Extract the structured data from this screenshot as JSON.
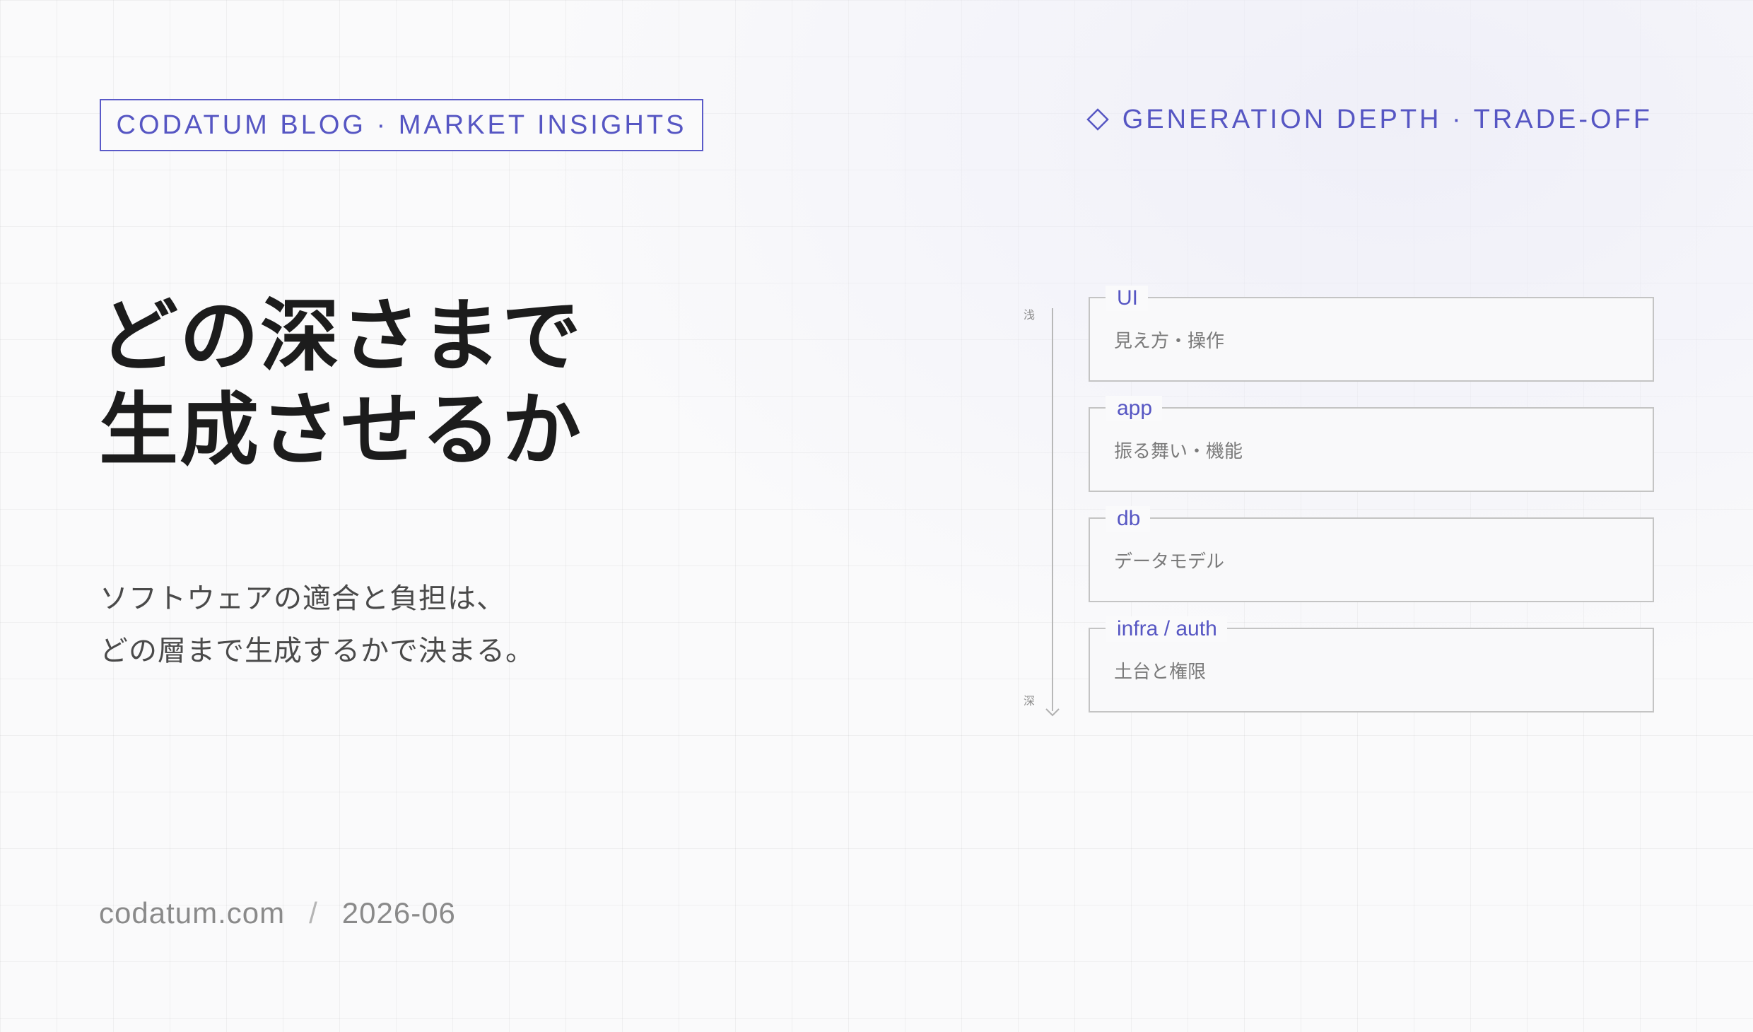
{
  "header": {
    "badge": "CODATUM BLOG · MARKET INSIGHTS",
    "section_tag": "GENERATION DEPTH · TRADE-OFF",
    "section_icon": "diamond-outline-icon"
  },
  "headline": {
    "line1": "どの深さまで",
    "line2": "生成させるか"
  },
  "subtext": {
    "line1": "ソフトウェアの適合と負担は、",
    "line2": "どの層まで生成するかで決まる。"
  },
  "footer": {
    "site": "codatum.com",
    "separator": "/",
    "date": "2026-06"
  },
  "axis": {
    "top_label": "浅",
    "bottom_label": "深",
    "arrow_icon": "chevron-down-icon"
  },
  "layers": [
    {
      "title": "UI",
      "desc": "見え方・操作"
    },
    {
      "title": "app",
      "desc": "振る舞い・機能"
    },
    {
      "title": "db",
      "desc": "データモデル"
    },
    {
      "title": "infra / auth",
      "desc": "土台と権限"
    }
  ],
  "colors": {
    "accent": "#5656c3",
    "background": "#fafafb",
    "headline": "#1c1c1c",
    "muted": "#8a8a8a"
  }
}
